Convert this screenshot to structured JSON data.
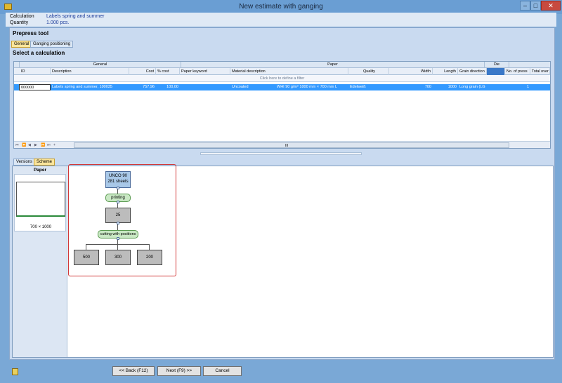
{
  "window": {
    "title": "New estimate with ganging",
    "min": "–",
    "max": "□",
    "close": "✕"
  },
  "info": {
    "calc_label": "Calculation",
    "calc_value": "Labels spring and summer",
    "qty_label": "Quantity",
    "qty_value": "1.000 pcs."
  },
  "panel": {
    "title": "Prepress tool",
    "tabs": [
      "General",
      "Ganging positioning"
    ],
    "active_tab": "General",
    "section": "Select a calculation"
  },
  "grid": {
    "bands": [
      "General",
      "Paper",
      "Die"
    ],
    "columns": [
      "ID",
      "Description",
      "Cost",
      "% cost",
      "Paper keyword",
      "Material description",
      "Quality",
      "Width",
      "Length",
      "Grain direction",
      "No. of press",
      "Total over"
    ],
    "filter_text": "Click here to define a filter",
    "rows": [
      {
        "id": "000000",
        "description": "Labels spring and summer, 100035",
        "cost": "757,96",
        "pct": "100,00",
        "keyword": "",
        "material": "Uncoated",
        "material_detail": "WHI 90 g/m² 1000 mm × 700 mm L",
        "quality": "Edelweiß",
        "width": "700",
        "length": "1000",
        "grain": "Long grain (LG",
        "press": "1",
        "total": ""
      }
    ],
    "nav": [
      "⏮",
      "⏪",
      "◀",
      "▶",
      "⏩",
      "⏭",
      "+"
    ],
    "scroll_thumb": "III"
  },
  "lower": {
    "tabs": [
      "Versions",
      "Scheme"
    ],
    "active_tab": "Scheme",
    "paper_title": "Paper",
    "paper_size": "700 × 1000",
    "scheme": {
      "root_line1": "UNCO 90",
      "root_line2": "281 sheets",
      "printing": "printing",
      "count": "25",
      "cutting": "cutting with positions",
      "outputs": [
        "500",
        "300",
        "200"
      ]
    }
  },
  "footer": {
    "back": "<< Back (F12)",
    "next": "Next (F9) >>",
    "cancel": "Cancel"
  }
}
